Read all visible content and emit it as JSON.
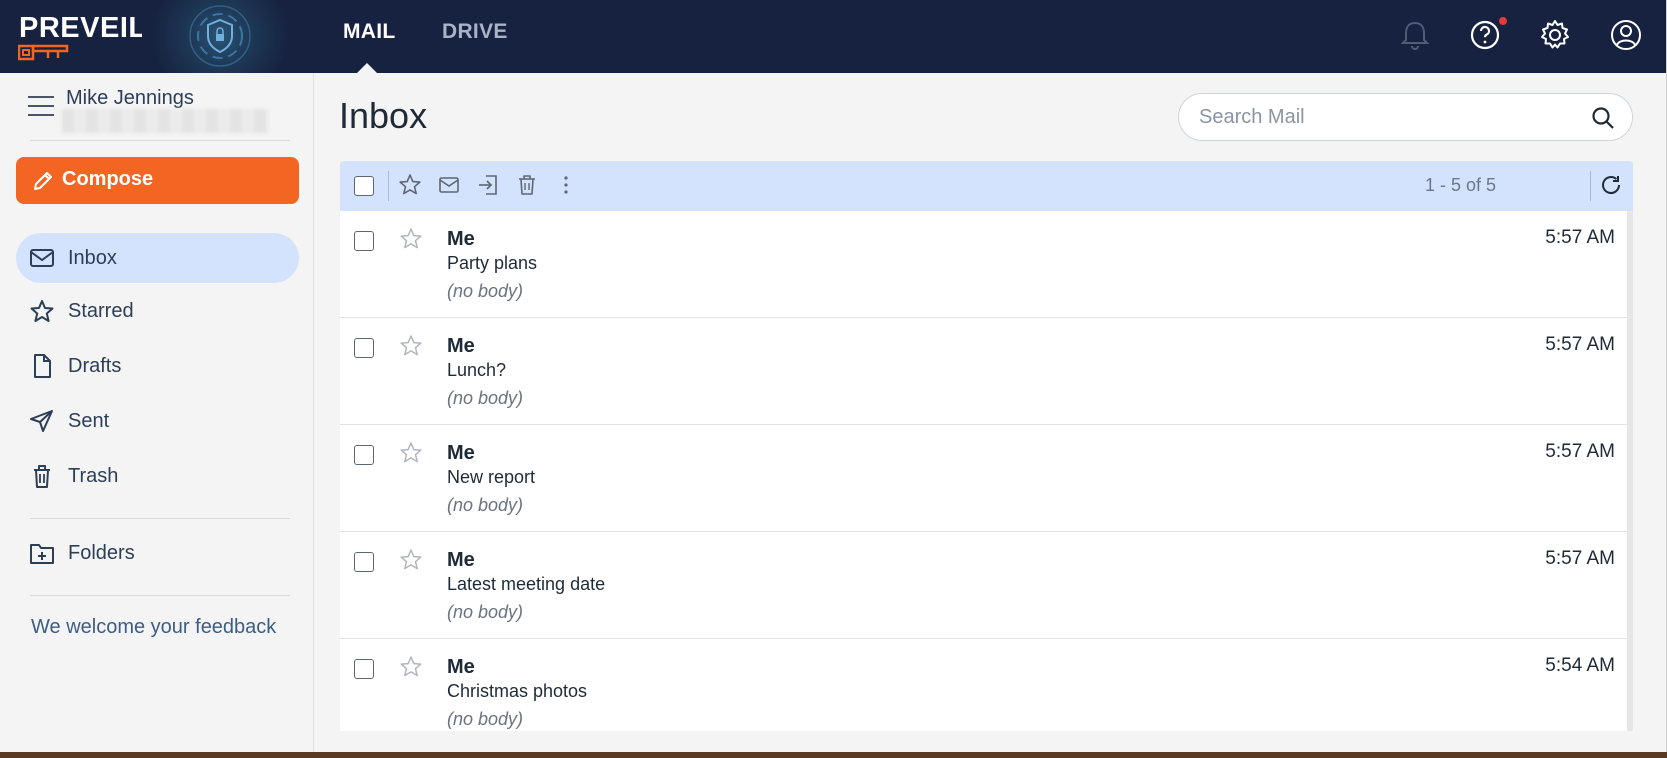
{
  "app": {
    "brand": "PREVEIL"
  },
  "topnav": {
    "tabs": [
      {
        "label": "MAIL",
        "active": true
      },
      {
        "label": "DRIVE",
        "active": false
      }
    ],
    "icons": [
      "bell-icon",
      "help-icon",
      "settings-gear-icon",
      "account-icon"
    ],
    "help_badge_color": "#e53935"
  },
  "sidebar": {
    "user_name": "Mike Jennings",
    "compose_label": "Compose",
    "items": [
      {
        "label": "Inbox",
        "icon": "mail-icon",
        "active": true
      },
      {
        "label": "Starred",
        "icon": "star-icon",
        "active": false
      },
      {
        "label": "Drafts",
        "icon": "draft-file-icon",
        "active": false
      },
      {
        "label": "Sent",
        "icon": "send-icon",
        "active": false
      },
      {
        "label": "Trash",
        "icon": "trash-icon",
        "active": false
      }
    ],
    "folders_label": "Folders",
    "feedback_label": "We welcome your feedback"
  },
  "main": {
    "title": "Inbox",
    "search_placeholder": "Search Mail",
    "pagination": "1 - 5 of 5"
  },
  "messages": [
    {
      "from": "Me",
      "subject": "Party plans",
      "preview": "(no body)",
      "time": "5:57 AM"
    },
    {
      "from": "Me",
      "subject": "Lunch?",
      "preview": "(no body)",
      "time": "5:57 AM"
    },
    {
      "from": "Me",
      "subject": "New report",
      "preview": "(no body)",
      "time": "5:57 AM"
    },
    {
      "from": "Me",
      "subject": "Latest meeting date",
      "preview": "(no body)",
      "time": "5:57 AM"
    },
    {
      "from": "Me",
      "subject": "Christmas photos",
      "preview": "(no body)",
      "time": "5:54 AM"
    }
  ],
  "colors": {
    "topbar": "#16223f",
    "accent": "#f26522",
    "selection": "#d3e3fd"
  }
}
